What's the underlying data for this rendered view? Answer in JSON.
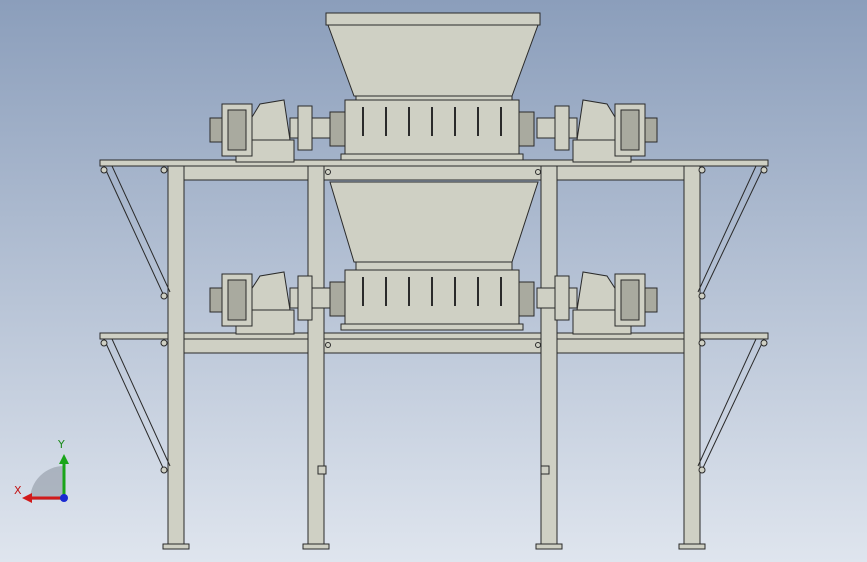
{
  "colors": {
    "bg_top": "#8b9ebb",
    "bg_bottom": "#dde3ec",
    "steel": "#cfd0c4",
    "steel_dark": "#a9aa9f",
    "outline": "#2a2a2a",
    "x_axis": "#d11a1a",
    "y_axis": "#1aa51a",
    "z_axis": "#1a2ad1"
  },
  "triad": {
    "x_label": "X",
    "y_label": "Y"
  }
}
